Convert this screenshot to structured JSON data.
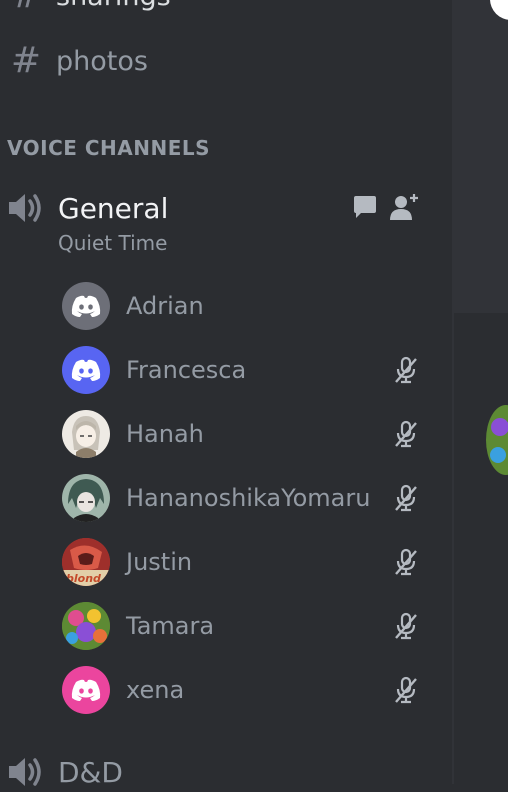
{
  "channels": {
    "top_partial": "sharings",
    "photos": "photos"
  },
  "voice_section": {
    "header": "VOICE CHANNELS"
  },
  "voice_channels": [
    {
      "name": "General",
      "status": "Quiet Time"
    },
    {
      "name": "D&D"
    }
  ],
  "users": [
    {
      "name": "Adrian",
      "avatar": "discord-logo",
      "avatar_color": "#6d6f78",
      "muted": false
    },
    {
      "name": "Francesca",
      "avatar": "discord-logo",
      "avatar_color": "#5865f2",
      "muted": true
    },
    {
      "name": "Hanah",
      "avatar": "anime-portrait",
      "avatar_color": "#e8e4df",
      "muted": true
    },
    {
      "name": "HananoshikaYomaru",
      "avatar": "anime-portrait",
      "avatar_color": "#7f9a8c",
      "muted": true
    },
    {
      "name": "Justin",
      "avatar": "album-cover",
      "avatar_color": "#c6463f",
      "muted": true
    },
    {
      "name": "Tamara",
      "avatar": "colorful-picture",
      "avatar_color": "#6a8a3a",
      "muted": true
    },
    {
      "name": "xena",
      "avatar": "discord-logo",
      "avatar_color": "#eb459e",
      "muted": true
    }
  ],
  "icons": {
    "chat": "chat-bubble-icon",
    "invite": "add-user-icon",
    "speaker": "speaker-icon",
    "muted": "mic-muted-icon"
  },
  "colors": {
    "sidebar_bg": "#2b2d31",
    "text_muted": "#949ba4",
    "text_bright": "#f2f3f5",
    "blurple": "#5865f2"
  }
}
